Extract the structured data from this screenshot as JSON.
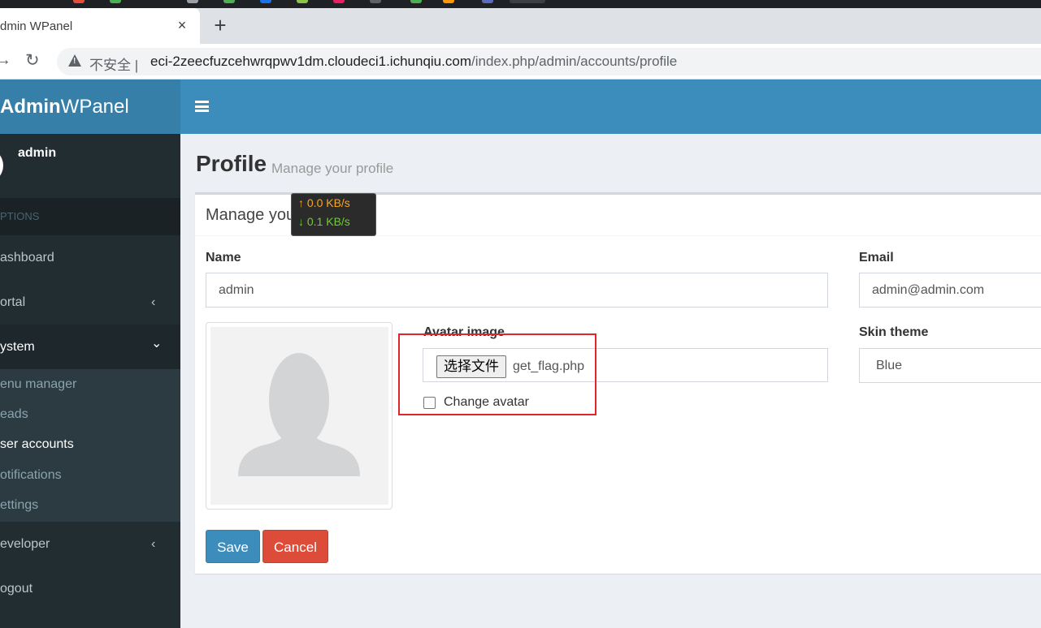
{
  "browser": {
    "tab_title": "dmin WPanel",
    "tab_close": "×",
    "new_tab": "+",
    "insecure_label": "不安全 |",
    "url_host": "eci-2zeecfuzcehwrqpwv1dm.cloudeci1.ichunqiu.com",
    "url_path": "/index.php/admin/accounts/profile"
  },
  "sidebar": {
    "logo_bold": "Admin",
    "logo_rest": "WPanel",
    "user_name": "admin",
    "section_header": "PTIONS",
    "items": [
      {
        "label": "ashboard"
      },
      {
        "label": "ortal",
        "chevron": "‹"
      },
      {
        "label": "ystem",
        "chevron": "⌄"
      },
      {
        "label": "eveloper",
        "chevron": "‹"
      },
      {
        "label": "ogout"
      }
    ],
    "submenu": [
      {
        "label": "enu manager"
      },
      {
        "label": "eads"
      },
      {
        "label": "ser accounts"
      },
      {
        "label": "otifications"
      },
      {
        "label": "ettings"
      }
    ]
  },
  "page": {
    "title": "Profile",
    "subtitle": "Manage your profile"
  },
  "form": {
    "box_title": "Manage your profile",
    "name_label": "Name",
    "name_value": "admin",
    "email_label": "Email",
    "email_value": "admin@admin.com",
    "avatar_label": "Avatar image",
    "file_button": "选择文件",
    "file_name": "get_flag.php",
    "change_avatar_label": "Change avatar",
    "skin_label": "Skin theme",
    "skin_value": "Blue",
    "save_label": "Save",
    "cancel_label": "Cancel"
  },
  "speed_overlay": {
    "up": "↑ 0.0 KB/s",
    "down": "↓ 0.1 KB/s"
  },
  "colors": {
    "primary": "#3c8dbc",
    "danger": "#dd4b39",
    "sidebar": "#222d32",
    "highlight": "#e0252b"
  }
}
